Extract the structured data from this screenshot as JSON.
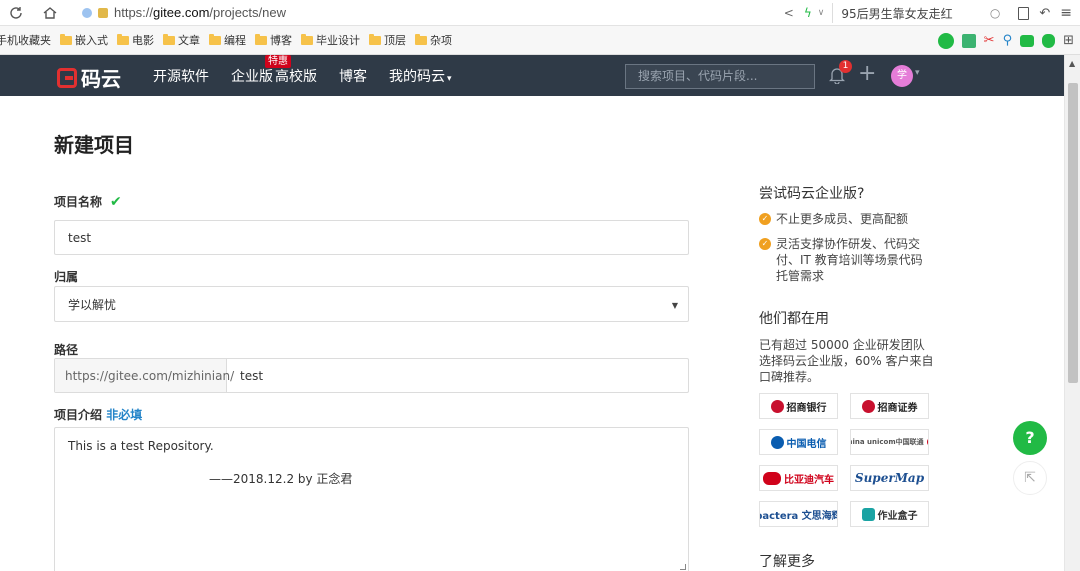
{
  "browser": {
    "url_prefix": "https://",
    "url_host": "gitee.com",
    "url_path": "/projects/new",
    "search_text": "95后男生靠女友走红",
    "bookmarks": [
      {
        "label": "手机收藏夹",
        "folder": false
      },
      {
        "label": "嵌入式",
        "folder": true
      },
      {
        "label": "电影",
        "folder": true
      },
      {
        "label": "文章",
        "folder": true
      },
      {
        "label": "编程",
        "folder": true
      },
      {
        "label": "博客",
        "folder": true
      },
      {
        "label": "毕业设计",
        "folder": true
      },
      {
        "label": "顶层",
        "folder": true
      },
      {
        "label": "杂项",
        "folder": true
      }
    ]
  },
  "header": {
    "logo_text": "码云",
    "nav": [
      {
        "label": "开源软件"
      },
      {
        "label": "企业版",
        "badge": "特惠"
      },
      {
        "label": "高校版"
      },
      {
        "label": "博客"
      },
      {
        "label": "我的码云",
        "dropdown": true
      }
    ],
    "search_placeholder": "搜索项目、代码片段...",
    "notification_count": "1",
    "avatar_text": "学"
  },
  "form": {
    "title": "新建项目",
    "name_label": "项目名称",
    "name_value": "test",
    "owner_label": "归属",
    "owner_value": "学以解忧",
    "path_label": "路径",
    "path_prefix": "https://gitee.com/mizhinian/",
    "path_value": "test",
    "desc_label": "项目介绍",
    "desc_optional": "非必填",
    "desc_line1": "This is a test Repository.",
    "desc_line2": "——2018.12.2 by 正念君"
  },
  "sidebar": {
    "try_title": "尝试码云企业版?",
    "benefits": [
      "不止更多成员、更高配额",
      "灵活支撑协作研发、代码交付、IT 教育培训等场景代码托管需求"
    ],
    "using_title": "他们都在用",
    "using_text": "已有超过 50000 企业研发团队选择码云企业版，60% 客户来自口碑推荐。",
    "brands": [
      {
        "name": "招商银行",
        "color": "#c8102e"
      },
      {
        "name": "招商证券",
        "color": "#c8102e"
      },
      {
        "name": "中国电信",
        "color": "#0a5db0"
      },
      {
        "name": "China unicom中国联通",
        "color": "#d0021b"
      },
      {
        "name": "比亚迪汽车",
        "color": "#d0021b"
      },
      {
        "name": "SuperMap",
        "color": "#1d4f91"
      },
      {
        "name": "pactera 文思海辉",
        "color": "#1d4f91"
      },
      {
        "name": "作业盒子",
        "color": "#1aa3a3"
      }
    ],
    "more_title": "了解更多"
  },
  "float": {
    "help_label": "?"
  }
}
